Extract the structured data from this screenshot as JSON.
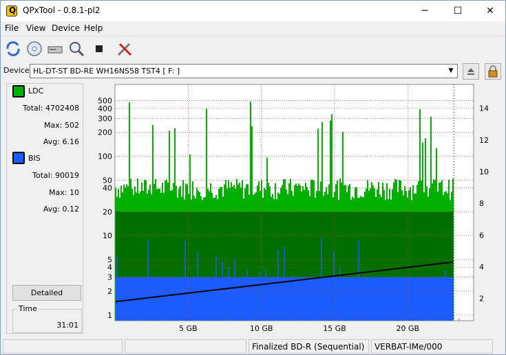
{
  "window": {
    "title": "QPxTool - 0.8.1-pl2",
    "minimize": "─",
    "maximize": "☐",
    "close": "✕"
  },
  "menu": [
    "File",
    "View",
    "Device",
    "Help"
  ],
  "toolbar": {
    "icons": [
      "refresh-icon",
      "disc-icon",
      "drive-icon",
      "scan-icon",
      "stop-icon",
      "settings-icon"
    ]
  },
  "device": {
    "label": "Device:",
    "value": "HL-DT-ST BD-RE  WH16NS58  TST4 [ F: ]"
  },
  "ldc": {
    "label": "LDC",
    "color": "#00b000",
    "total": "Total: 4702408",
    "max": "Max: 502",
    "avg": "Avg: 6.16"
  },
  "bis": {
    "label": "BIS",
    "color": "#1a5cff",
    "total": "Total: 90019",
    "max": "Max: 10",
    "avg": "Avg: 0.12"
  },
  "detailed_label": "Detailed",
  "time": {
    "label": "Time",
    "value": "31:01"
  },
  "chart_data": {
    "type": "area",
    "x_ticks": [
      "5 GB",
      "10 GB",
      "15 GB",
      "20 GB"
    ],
    "x_tick_values": [
      5,
      10,
      15,
      20
    ],
    "x_max_data": 23.1,
    "xlim": [
      0,
      24.5
    ],
    "y_left_ticks": [
      "1",
      "2",
      "3",
      "4",
      "5",
      "10",
      "20",
      "40",
      "50",
      "100",
      "200",
      "300",
      "400",
      "500"
    ],
    "y_left_tick_values": [
      1,
      2,
      3,
      4,
      5,
      10,
      20,
      40,
      50,
      100,
      200,
      300,
      400,
      500
    ],
    "y_left_scale": "log",
    "y_right_ticks": [
      "2",
      "4",
      "6",
      "8",
      "10",
      "12",
      "14"
    ],
    "y_right_tick_values": [
      2,
      4,
      6,
      8,
      10,
      12,
      14
    ],
    "speed_line": {
      "start": 1.8,
      "end": 4.3
    },
    "series": [
      {
        "name": "LDC",
        "color": "#00b000",
        "typical": 35,
        "peak": 502
      },
      {
        "name": "BIS",
        "color": "#1a5cff",
        "typical": 3,
        "peak": 10
      }
    ],
    "grid": true
  },
  "status": [
    "",
    "",
    "Finalized BD-R (Sequential)",
    "VERBAT-IMe/000"
  ]
}
